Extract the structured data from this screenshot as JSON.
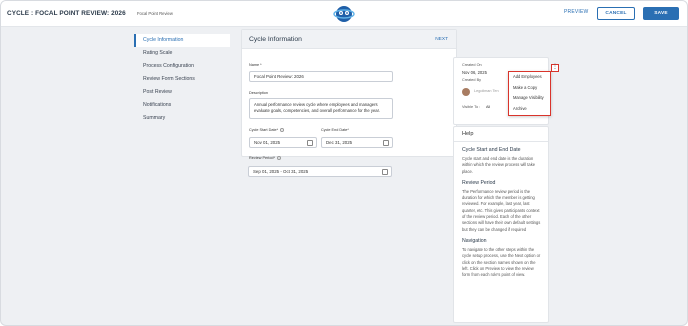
{
  "header": {
    "title": "CYCLE : FOCAL POINT REVIEW: 2026",
    "subtitle": "Focal Point Review",
    "preview_label": "PREVIEW",
    "cancel_label": "CANCEL",
    "save_label": "SAVE"
  },
  "nav": {
    "items": [
      {
        "label": "Cycle Information",
        "active": true
      },
      {
        "label": "Rating Scale"
      },
      {
        "label": "Process Configuration"
      },
      {
        "label": "Review Form Sections"
      },
      {
        "label": "Post Review"
      },
      {
        "label": "Notifications"
      },
      {
        "label": "Summary"
      }
    ]
  },
  "main": {
    "title": "Cycle Information",
    "next_label": "NEXT",
    "name_label": "Name *",
    "name_value": "Focal Point Review: 2026",
    "description_label": "Description",
    "description_value": "Annual performance review cycle where employees and managers evaluate goals, competencies, and overall performance for the year.",
    "start_label": "Cycle Start Date*",
    "start_value": "Nov 01, 2025",
    "end_label": "Cycle End Date*",
    "end_value": "Dec 31, 2025",
    "period_label": "Review Period*",
    "period_value": "Sep 01, 2025 - Oct 31, 2025"
  },
  "meta": {
    "created_on_label": "Created On",
    "created_on_value": "Nov 06, 2025",
    "created_by_label": "Created By",
    "creator_name": "Legoliman Ten",
    "visible_to_label": "Visible To :",
    "visible_to_value": "All",
    "kebab_glyph": "⋮"
  },
  "menu": {
    "items": [
      "Add Employees",
      "Make a Copy",
      "Manage Visibility",
      "Archive"
    ]
  },
  "help": {
    "title": "Help",
    "sections": [
      {
        "heading": "Cycle Start and End Date",
        "text": "Cycle start and end date is the duration within which the review process will take place."
      },
      {
        "heading": "Review Period",
        "text": "The Performance review period is the duration for which the member is getting reviewed. For example, last year, last quarter, etc. This gives participants context of the review period. Each of the other sections will have their own default settings but they can be changed if required"
      },
      {
        "heading": "Navigation",
        "text": "To navigate to the other steps within the cycle setup process, use the Next option or click on the section names shown on the left. Click on Preview to view the review form from each role's point of view."
      }
    ]
  },
  "colors": {
    "accent": "#2a6fb3",
    "highlight": "#d9342b",
    "background": "#eef0f3"
  }
}
